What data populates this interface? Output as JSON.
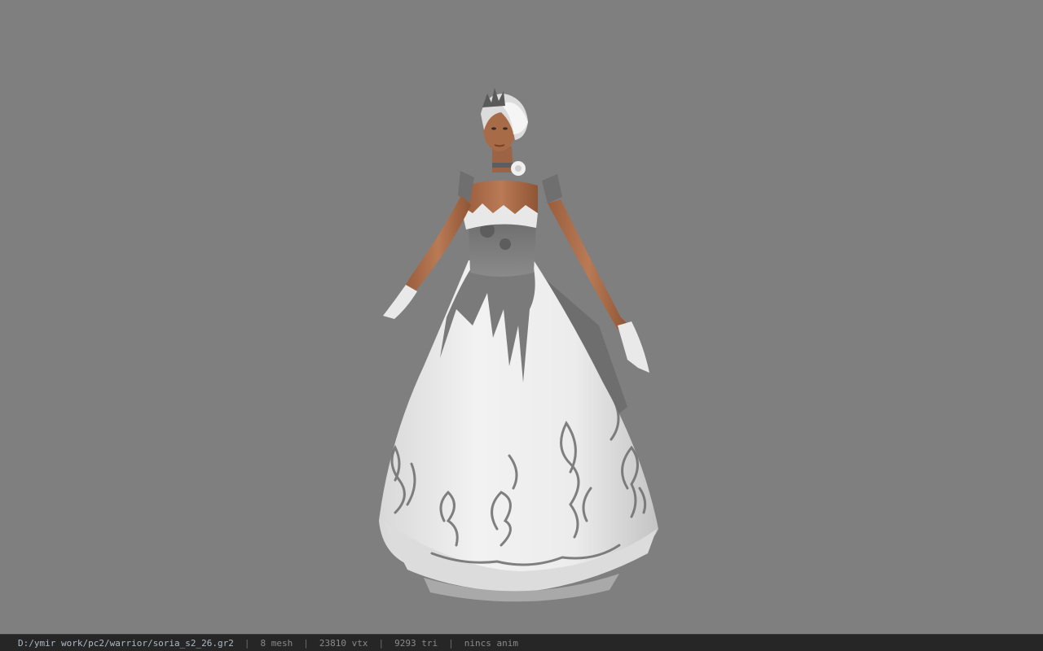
{
  "viewer": {
    "background_color": "#808080",
    "model_subject": "3d-character-model"
  },
  "statusbar": {
    "file_path": "D:/ymir work/pc2/warrior/soria_s2_26.gr2",
    "separator": "|",
    "mesh_count": "8 mesh",
    "vertex_count": "23810 vtx",
    "triangle_count": "9293 tri",
    "anim_status": "nincs anim"
  }
}
